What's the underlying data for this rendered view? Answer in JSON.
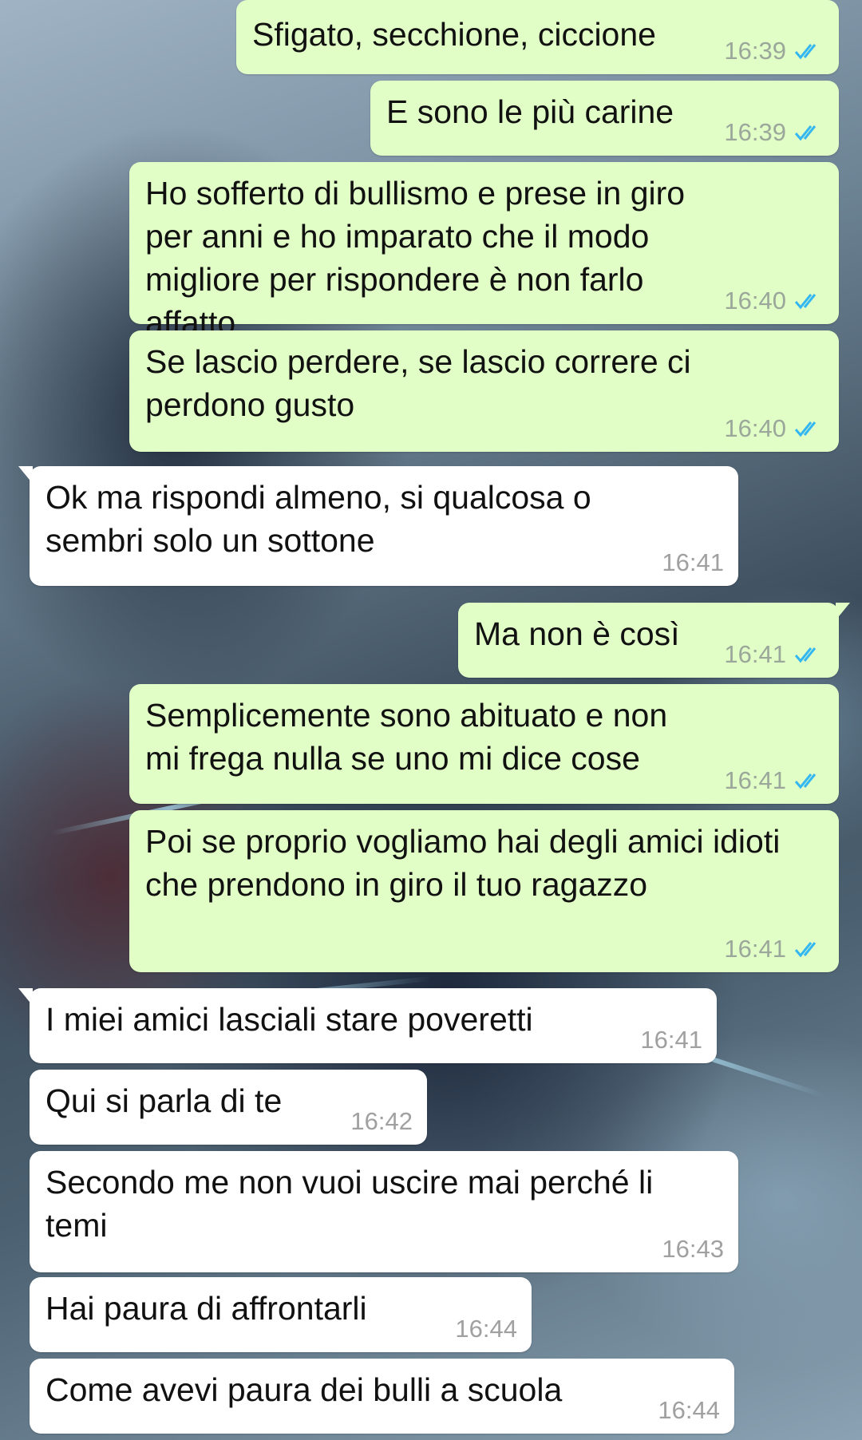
{
  "messages": [
    {
      "direction": "outgoing",
      "text": "Sfigato, secchione, ciccione",
      "time": "16:39",
      "status_icon": "double-check-read-icon"
    },
    {
      "direction": "outgoing",
      "text": "E sono le più carine",
      "time": "16:39",
      "status_icon": "double-check-read-icon"
    },
    {
      "direction": "outgoing",
      "text": "Ho sofferto di bullismo e prese in giro per anni e ho imparato che il modo migliore per rispondere è non farlo affatto",
      "time": "16:40",
      "status_icon": "double-check-read-icon"
    },
    {
      "direction": "outgoing",
      "text": "Se lascio perdere, se lascio correre ci perdono gusto",
      "time": "16:40",
      "status_icon": "double-check-read-icon"
    },
    {
      "direction": "incoming",
      "text": "Ok ma rispondi almeno, si qualcosa o sembri solo un sottone",
      "time": "16:41"
    },
    {
      "direction": "outgoing",
      "text": "Ma non è così",
      "time": "16:41",
      "status_icon": "double-check-read-icon"
    },
    {
      "direction": "outgoing",
      "text": "Semplicemente sono abituato e non mi frega nulla se uno mi dice cose",
      "time": "16:41",
      "status_icon": "double-check-read-icon"
    },
    {
      "direction": "outgoing",
      "text": "Poi se proprio vogliamo hai degli amici idioti che prendono in giro il tuo ragazzo",
      "time": "16:41",
      "status_icon": "double-check-read-icon"
    },
    {
      "direction": "incoming",
      "text": "I miei amici lasciali stare poveretti",
      "time": "16:41"
    },
    {
      "direction": "incoming",
      "text": "Qui si parla di te",
      "time": "16:42"
    },
    {
      "direction": "incoming",
      "text": "Secondo me non vuoi uscire mai perché li temi",
      "time": "16:43"
    },
    {
      "direction": "incoming",
      "text": "Hai paura di affrontarli",
      "time": "16:44"
    },
    {
      "direction": "incoming",
      "text": "Come avevi paura dei bulli a scuola",
      "time": "16:44"
    }
  ],
  "colors": {
    "outgoing_bubble": "#e1fec6",
    "incoming_bubble": "#ffffff",
    "read_ticks": "#34b7f1"
  }
}
